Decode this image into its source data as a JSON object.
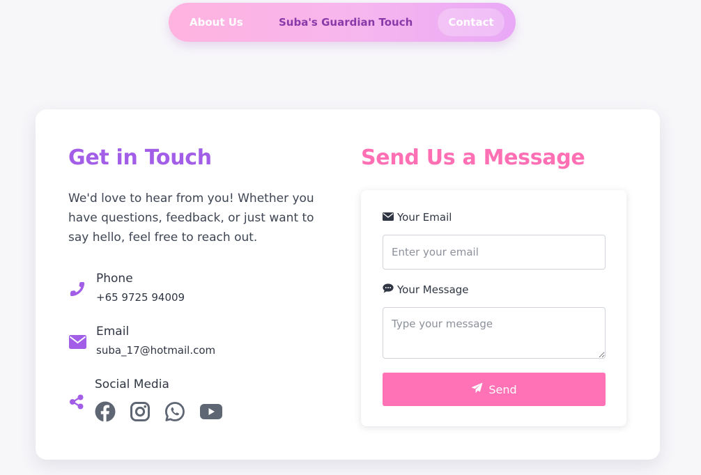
{
  "nav": {
    "about_label": "About Us",
    "brand_label": "Suba's Guardian Touch",
    "contact_label": "Contact"
  },
  "contact_info": {
    "title": "Get in Touch",
    "intro": "We'd love to hear from you! Whether you have questions, feedback, or just want to say hello, feel free to reach out.",
    "phone": {
      "label": "Phone",
      "value": "+65 9725 94009",
      "icon": "phone-icon"
    },
    "email": {
      "label": "Email",
      "value": "suba_17@hotmail.com",
      "icon": "envelope-icon"
    },
    "social": {
      "label": "Social Media",
      "icon": "share-icon",
      "networks": [
        "facebook-icon",
        "instagram-icon",
        "whatsapp-icon",
        "youtube-icon"
      ]
    }
  },
  "form": {
    "title": "Send Us a Message",
    "email_label": "Your Email",
    "email_placeholder": "Enter your email",
    "email_value": "",
    "message_label": "Your Message",
    "message_placeholder": "Type your message",
    "message_value": "",
    "send_label": "Send"
  },
  "colors": {
    "purple_accent": "#a35ee8",
    "pink_accent": "#ff6fb4",
    "send_button": "#ff72b6",
    "brand_text": "#8a3aa8",
    "social_icon": "#5f6673",
    "page_background": "#f7f7fa"
  }
}
